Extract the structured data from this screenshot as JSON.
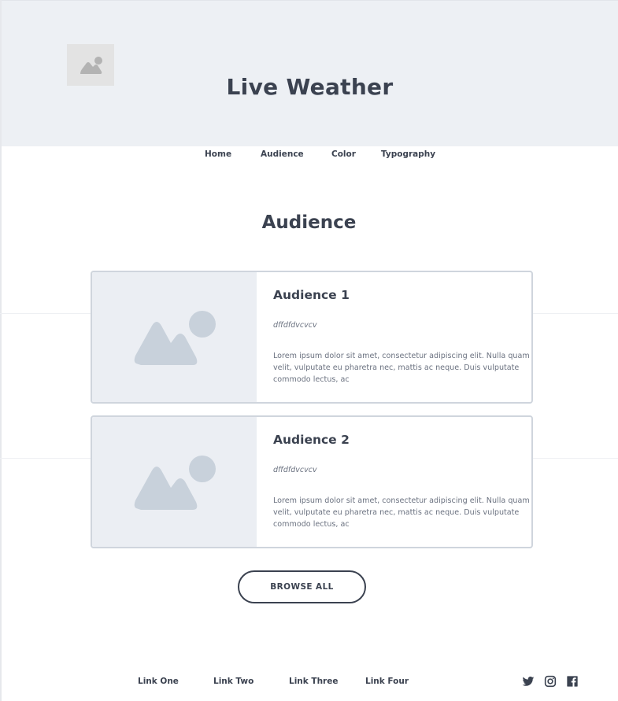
{
  "header": {
    "logo_icon": "image-placeholder-icon",
    "title": "Live Weather"
  },
  "nav": {
    "items": [
      {
        "label": "Home"
      },
      {
        "label": "Audience"
      },
      {
        "label": "Color"
      },
      {
        "label": "Typography"
      }
    ]
  },
  "main": {
    "section_title": "Audience",
    "cards": [
      {
        "image_icon": "image-placeholder-icon",
        "title": "Audience 1",
        "subtitle": "dffdfdvcvcv",
        "text": "Lorem ipsum dolor sit amet, consectetur adipiscing elit. Nulla quam velit, vulputate eu pharetra nec, mattis ac neque. Duis vulputate commodo lectus, ac"
      },
      {
        "image_icon": "image-placeholder-icon",
        "title": "Audience 2",
        "subtitle": "dffdfdvcvcv",
        "text": "Lorem ipsum dolor sit amet, consectetur adipiscing elit. Nulla quam velit, vulputate eu pharetra nec, mattis ac neque. Duis vulputate commodo lectus, ac"
      }
    ],
    "browse_label": "BROWSE ALL"
  },
  "footer": {
    "links": [
      {
        "label": "Link One"
      },
      {
        "label": "Link Two"
      },
      {
        "label": "Link Three"
      },
      {
        "label": "Link Four"
      }
    ],
    "social": [
      "twitter-icon",
      "instagram-icon",
      "facebook-icon"
    ]
  },
  "colors": {
    "text": "#3b4250",
    "muted_text": "#6b7280",
    "hero_bg": "#edf0f4",
    "card_border": "#cfd5dd",
    "placeholder_shape": "#c8d1db"
  }
}
